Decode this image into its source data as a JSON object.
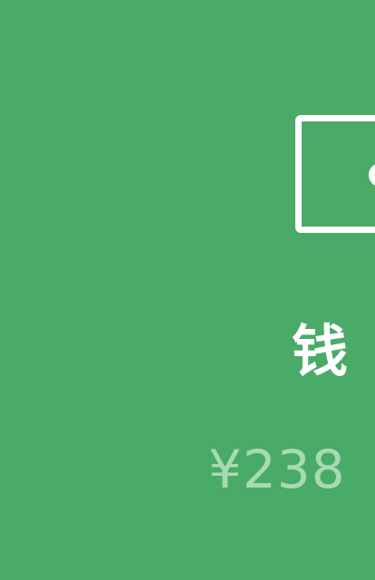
{
  "wallet": {
    "label": "钱",
    "amount": "¥238",
    "icon": "wallet-icon",
    "colors": {
      "background": "#4aab68",
      "label": "#ffffff",
      "amount": "#a7dab3"
    }
  }
}
